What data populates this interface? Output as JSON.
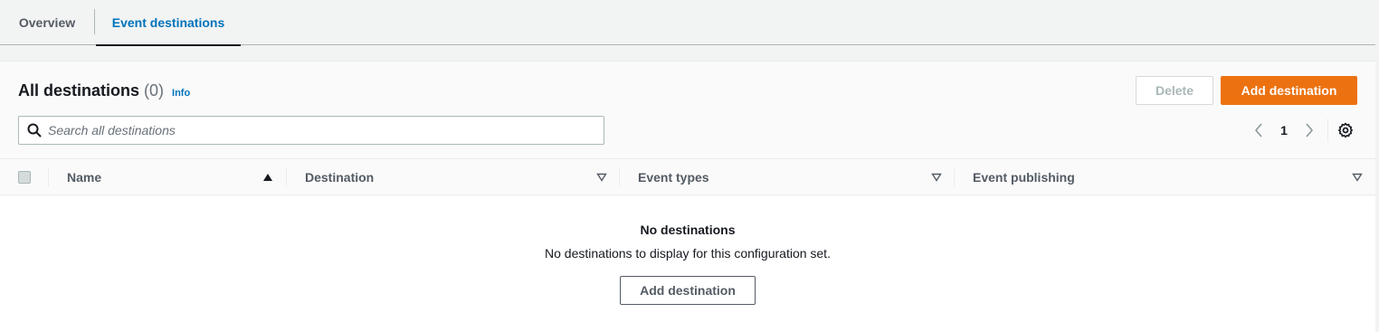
{
  "tabs": [
    {
      "label": "Overview",
      "active": false
    },
    {
      "label": "Event destinations",
      "active": true
    }
  ],
  "header": {
    "title": "All destinations",
    "count": "(0)",
    "info_label": "Info"
  },
  "actions": {
    "delete_label": "Delete",
    "add_label": "Add destination"
  },
  "search": {
    "placeholder": "Search all destinations",
    "value": ""
  },
  "pagination": {
    "current_page": "1"
  },
  "table": {
    "columns": [
      {
        "label": "Name",
        "sort": "ascending"
      },
      {
        "label": "Destination",
        "sort": "none"
      },
      {
        "label": "Event types",
        "sort": "none"
      },
      {
        "label": "Event publishing",
        "sort": "none"
      }
    ]
  },
  "empty_state": {
    "title": "No destinations",
    "description": "No destinations to display for this configuration set.",
    "button_label": "Add destination"
  },
  "colors": {
    "accent": "#0073bb",
    "primary_button": "#ec7211"
  },
  "icons": {
    "search": "search-icon",
    "prev": "chevron-left-icon",
    "next": "chevron-right-icon",
    "settings": "gear-icon",
    "sort_asc": "sort-ascending-icon",
    "sort_none": "sort-descending-outline-icon"
  }
}
